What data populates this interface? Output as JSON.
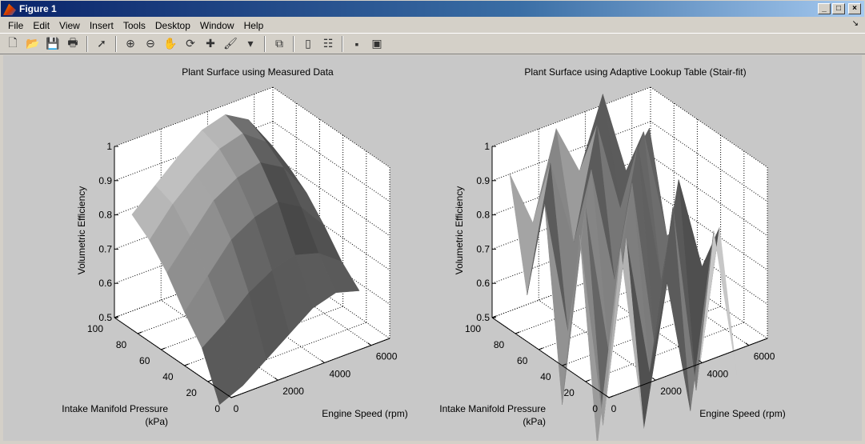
{
  "window": {
    "title": "Figure 1",
    "minimize": "_",
    "maximize": "□",
    "close": "×"
  },
  "menu": [
    "File",
    "Edit",
    "View",
    "Insert",
    "Tools",
    "Desktop",
    "Window",
    "Help"
  ],
  "menu_arrow": "↘",
  "toolbar": [
    {
      "name": "new-figure-icon",
      "glyph": "🗋"
    },
    {
      "name": "open-file-icon",
      "glyph": "📂"
    },
    {
      "name": "save-icon",
      "glyph": "💾"
    },
    {
      "name": "print-icon",
      "glyph": "🖶"
    },
    {
      "sep": true
    },
    {
      "name": "edit-plot-arrow-icon",
      "glyph": "➚"
    },
    {
      "sep": true
    },
    {
      "name": "zoom-in-icon",
      "glyph": "⊕"
    },
    {
      "name": "zoom-out-icon",
      "glyph": "⊖"
    },
    {
      "name": "pan-hand-icon",
      "glyph": "✋"
    },
    {
      "name": "rotate-3d-icon",
      "glyph": "⟳"
    },
    {
      "name": "data-cursor-icon",
      "glyph": "✚"
    },
    {
      "name": "brush-icon",
      "glyph": "🖌"
    },
    {
      "name": "brush-dropdown-icon",
      "glyph": "▾"
    },
    {
      "sep": true
    },
    {
      "name": "link-plot-icon",
      "glyph": "⧉"
    },
    {
      "sep": true
    },
    {
      "name": "colorbar-icon",
      "glyph": "▯"
    },
    {
      "name": "legend-icon",
      "glyph": "☷"
    },
    {
      "sep": true
    },
    {
      "name": "hide-plot-tools-icon",
      "glyph": "▪"
    },
    {
      "name": "show-plot-tools-icon",
      "glyph": "▣"
    }
  ],
  "chart_data": [
    {
      "type": "surface",
      "title": "Plant Surface using Measured Data",
      "xlabel": "Engine Speed (rpm)",
      "ylabel": [
        "Intake Manifold Pressure",
        "(kPa)"
      ],
      "zlabel": "Volumetric Efficiency",
      "xlim": [
        0,
        6800
      ],
      "ylim": [
        0,
        100
      ],
      "zlim": [
        0.5,
        1
      ],
      "xticks": [
        0,
        2000,
        4000,
        6000
      ],
      "yticks": [
        0,
        20,
        40,
        60,
        80,
        100
      ],
      "zticks": [
        0.5,
        0.6,
        0.7,
        0.8,
        0.9,
        1
      ],
      "grid": true,
      "color": "#808080",
      "x": [
        500,
        1500,
        2500,
        3500,
        4500,
        5500,
        6500
      ],
      "y": [
        20,
        35,
        50,
        65,
        80,
        95
      ],
      "z": [
        [
          0.42,
          0.45,
          0.5,
          0.55,
          0.6,
          0.62,
          0.6
        ],
        [
          0.55,
          0.6,
          0.66,
          0.7,
          0.72,
          0.7,
          0.65
        ],
        [
          0.62,
          0.7,
          0.78,
          0.82,
          0.84,
          0.8,
          0.72
        ],
        [
          0.7,
          0.78,
          0.86,
          0.9,
          0.92,
          0.88,
          0.78
        ],
        [
          0.76,
          0.84,
          0.9,
          0.95,
          0.97,
          0.92,
          0.82
        ],
        [
          0.8,
          0.86,
          0.92,
          0.97,
          0.99,
          0.95,
          0.85
        ]
      ]
    },
    {
      "type": "surface",
      "title": "Plant Surface using Adaptive Lookup Table (Stair-fit)",
      "xlabel": "Engine Speed (rpm)",
      "ylabel": [
        "Intake Manifold Pressure",
        "(kPa)"
      ],
      "zlabel": "Volumetric Efficiency",
      "xlim": [
        0,
        6800
      ],
      "ylim": [
        0,
        100
      ],
      "zlim": [
        0.5,
        1
      ],
      "xticks": [
        0,
        2000,
        4000,
        6000
      ],
      "yticks": [
        0,
        20,
        40,
        60,
        80,
        100
      ],
      "zticks": [
        0.5,
        0.6,
        0.7,
        0.8,
        0.9,
        1
      ],
      "grid": true,
      "color": "#808080",
      "x": [
        500,
        1500,
        2500,
        3500,
        4500,
        5500,
        6500
      ],
      "y": [
        20,
        35,
        50,
        65,
        80,
        95
      ],
      "z": [
        [
          0.3,
          0.85,
          0.3,
          0.7,
          0.3,
          0.8,
          0.35
        ],
        [
          0.88,
          0.3,
          0.82,
          0.4,
          0.86,
          0.3,
          0.75
        ],
        [
          0.35,
          0.9,
          0.45,
          0.92,
          0.4,
          0.88,
          0.6
        ],
        [
          0.9,
          0.5,
          0.95,
          0.6,
          0.97,
          0.55,
          0.7
        ],
        [
          0.6,
          0.96,
          0.7,
          1.02,
          0.75,
          0.95,
          0.62
        ],
        [
          0.92,
          0.75,
          1.0,
          0.85,
          1.05,
          0.8,
          0.9
        ]
      ]
    }
  ]
}
